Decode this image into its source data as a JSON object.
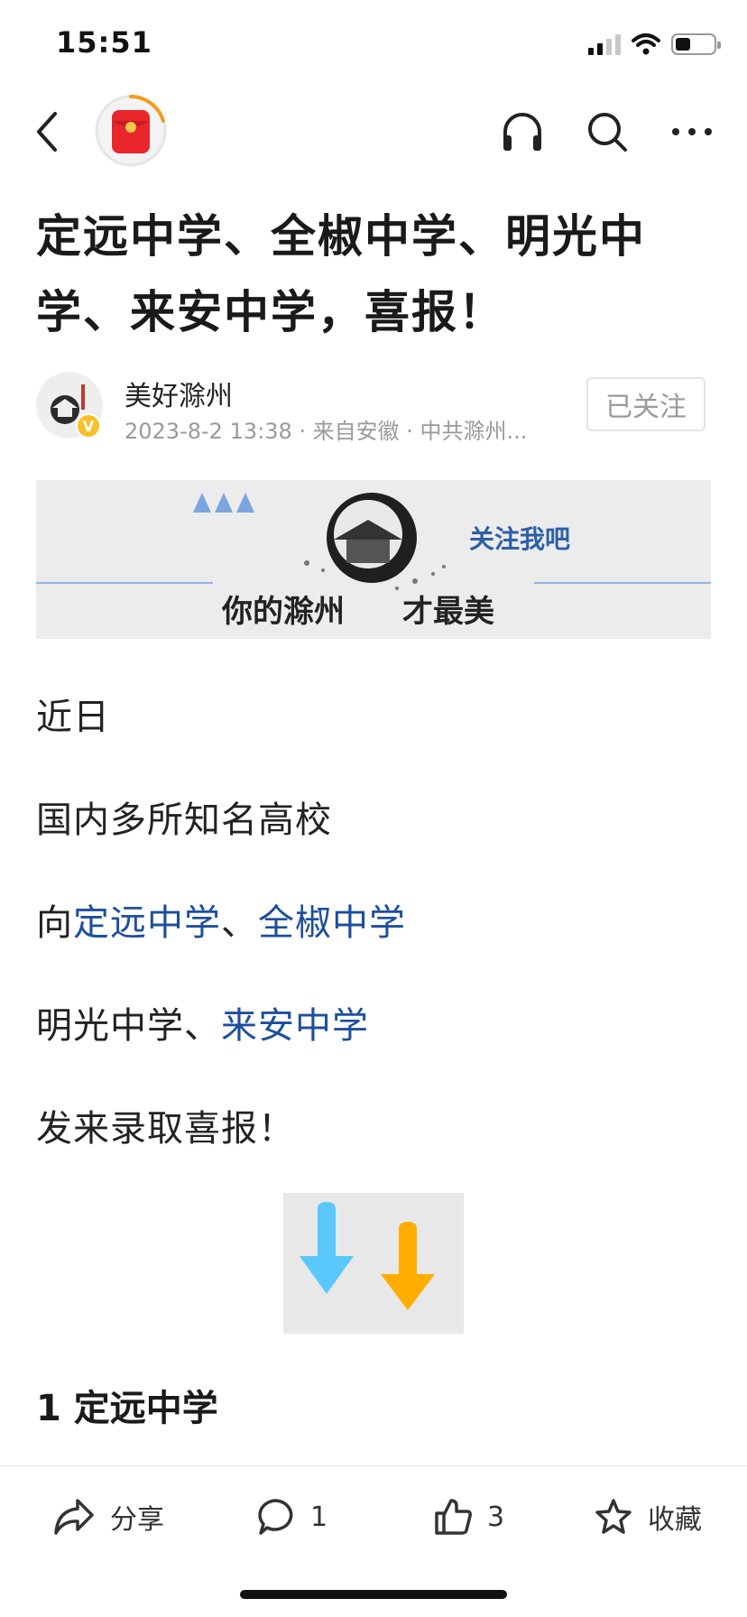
{
  "status_bar": {
    "time": "15:51"
  },
  "nav": {
    "back_icon": "chevron-left-icon",
    "avatar_icon": "red-packet-icon",
    "actions": [
      "headphones-icon",
      "search-icon",
      "more-icon"
    ]
  },
  "article": {
    "title": "定远中学、全椒中学、明光中学、来安中学，喜报！",
    "author": {
      "name": "美好滁州",
      "meta": "2023-8-2 13:38 · 来自安徽 · 中共滁州...",
      "follow_label": "已关注",
      "avatar_text": "美好滁州",
      "badge": "V"
    },
    "banner": {
      "follow_text": "关注我吧",
      "slogan_left": "你的滁州",
      "slogan_right": "才最美"
    },
    "paragraphs": {
      "p1": "近日",
      "p2": "国内多所知名高校",
      "p3_prefix": "向",
      "p3_link1": "定远中学",
      "p3_sep": "、",
      "p3_link2": "全椒中学",
      "p4_prefix": "明光中学、",
      "p4_link": "来安中学",
      "p5": "发来录取喜报！"
    },
    "section_heading": "1 定远中学"
  },
  "bottom_bar": {
    "share_label": "分享",
    "comment_count": "1",
    "like_count": "3",
    "favorite_label": "收藏"
  },
  "colors": {
    "link": "#1e4f9e",
    "accent_orange": "#f39a1e",
    "arrow_blue": "#5ac8fa",
    "arrow_orange": "#ffae00"
  }
}
